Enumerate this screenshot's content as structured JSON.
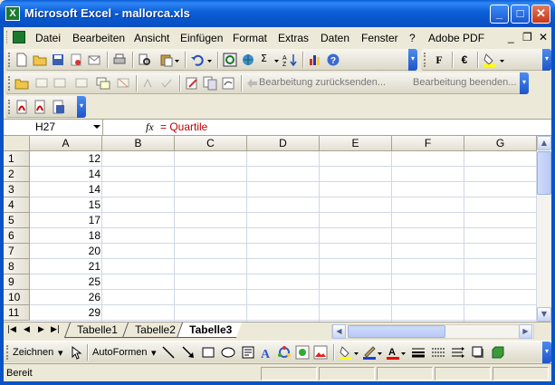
{
  "window": {
    "title": "Microsoft Excel - mallorca.xls",
    "minimize": "_",
    "maximize": "□",
    "close": "✕"
  },
  "menu": {
    "items": [
      "Datei",
      "Bearbeiten",
      "Ansicht",
      "Einfügen",
      "Format",
      "Extras",
      "Daten",
      "Fenster",
      "?",
      "Adobe PDF"
    ],
    "doc_min": "_",
    "doc_restore": "❐",
    "doc_close": "✕"
  },
  "toolbar": {
    "sigma": "Σ",
    "font_bold": "F",
    "euro": "€",
    "review_send": "Bearbeitung zurücksenden...",
    "review_end": "Bearbeitung beenden..."
  },
  "formula_bar": {
    "cell_ref": "H27",
    "fx": "fx",
    "formula": "= Quartile"
  },
  "grid": {
    "columns": [
      "A",
      "B",
      "C",
      "D",
      "E",
      "F",
      "G"
    ],
    "rows": [
      "1",
      "2",
      "3",
      "4",
      "5",
      "6",
      "7",
      "8",
      "9",
      "10",
      "11"
    ],
    "column_a_values": [
      "12",
      "14",
      "14",
      "15",
      "17",
      "18",
      "20",
      "21",
      "25",
      "26",
      "29"
    ]
  },
  "sheets": {
    "tabs": [
      "Tabelle1",
      "Tabelle2",
      "Tabelle3"
    ],
    "active": "Tabelle3"
  },
  "drawing_toolbar": {
    "zeichnen": "Zeichnen",
    "autoformen": "AutoFormen"
  },
  "status": {
    "text": "Bereit"
  },
  "colors": {
    "title_blue": "#0a5fd6",
    "formula_red": "#c00000",
    "grid_line": "#d0d7e5",
    "excel_green": "#1b7a2e"
  }
}
